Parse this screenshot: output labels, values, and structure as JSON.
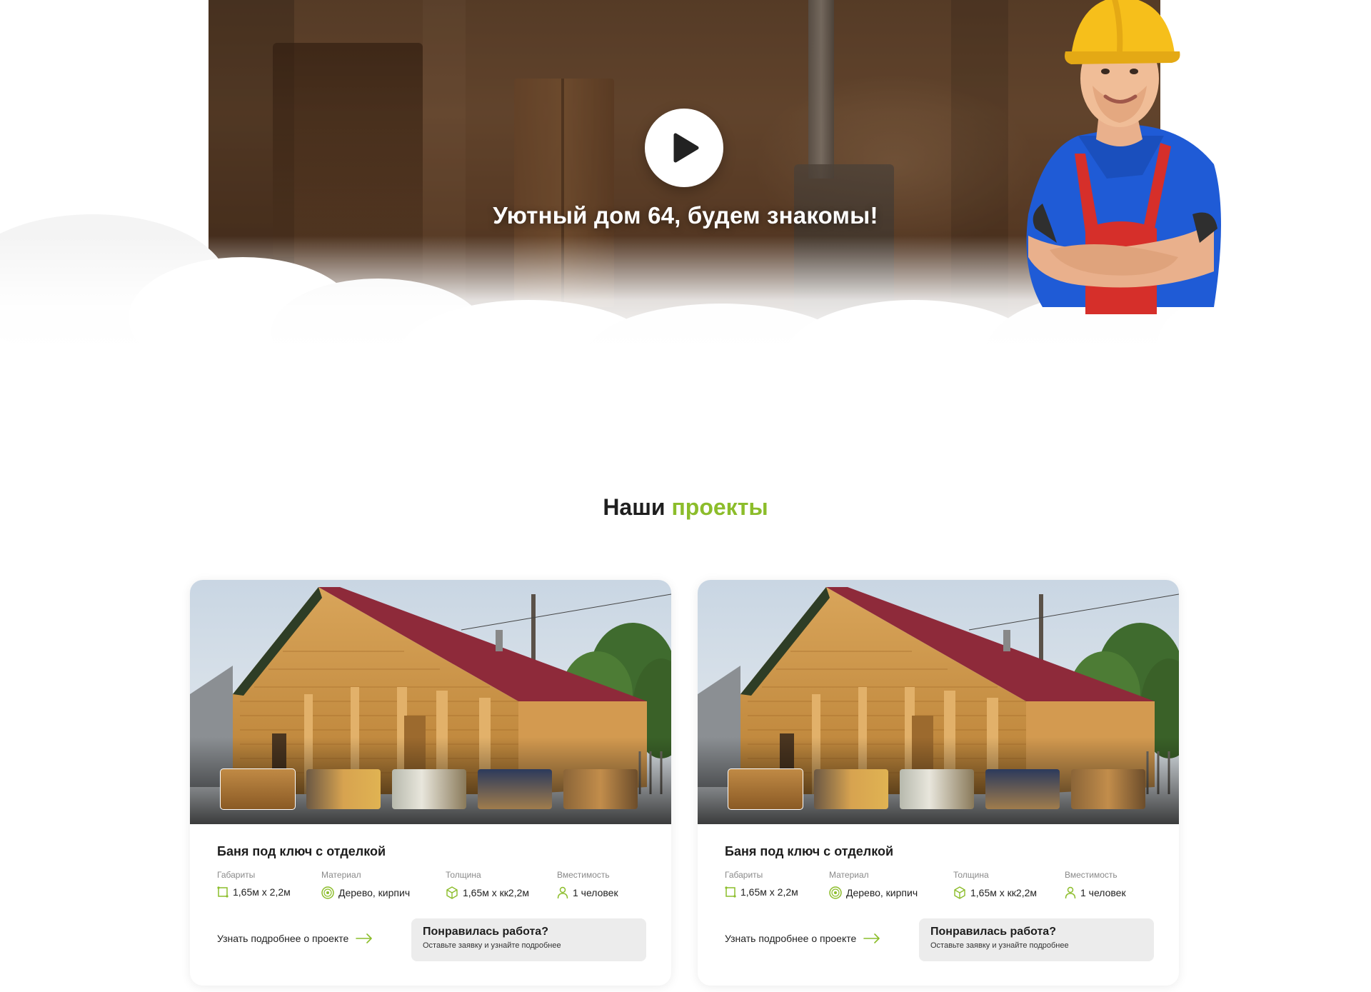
{
  "video": {
    "caption": "Уютный дом 64, будем знакомы!",
    "play_icon": "play-icon"
  },
  "section": {
    "title_main": "Наши",
    "title_accent": "проекты",
    "accent_color": "#8cbd2b"
  },
  "projects": [
    {
      "title": "Баня под ключ с отделкой",
      "specs": [
        {
          "label": "Габариты",
          "value": "1,65м х 2,2м",
          "icon": "dimensions-icon"
        },
        {
          "label": "Материал",
          "value": "Дерево, кирпич",
          "icon": "material-icon"
        },
        {
          "label": "Толщина",
          "value": "1,65м х кк2,2м",
          "icon": "thickness-icon"
        },
        {
          "label": "Вместимость",
          "value": "1 человек",
          "icon": "person-icon"
        }
      ],
      "more_link": "Узнать подробнее о проекте",
      "cta_title": "Понравилась работа?",
      "cta_subtitle": "Оставьте заявку и узнайте подробнее"
    },
    {
      "title": "Баня под ключ с отделкой",
      "specs": [
        {
          "label": "Габариты",
          "value": "1,65м х 2,2м",
          "icon": "dimensions-icon"
        },
        {
          "label": "Материал",
          "value": "Дерево, кирпич",
          "icon": "material-icon"
        },
        {
          "label": "Толщина",
          "value": "1,65м х кк2,2м",
          "icon": "thickness-icon"
        },
        {
          "label": "Вместимость",
          "value": "1 человек",
          "icon": "person-icon"
        }
      ],
      "more_link": "Узнать подробнее о проекте",
      "cta_title": "Понравилась работа?",
      "cta_subtitle": "Оставьте заявку и узнайте подробнее"
    }
  ]
}
